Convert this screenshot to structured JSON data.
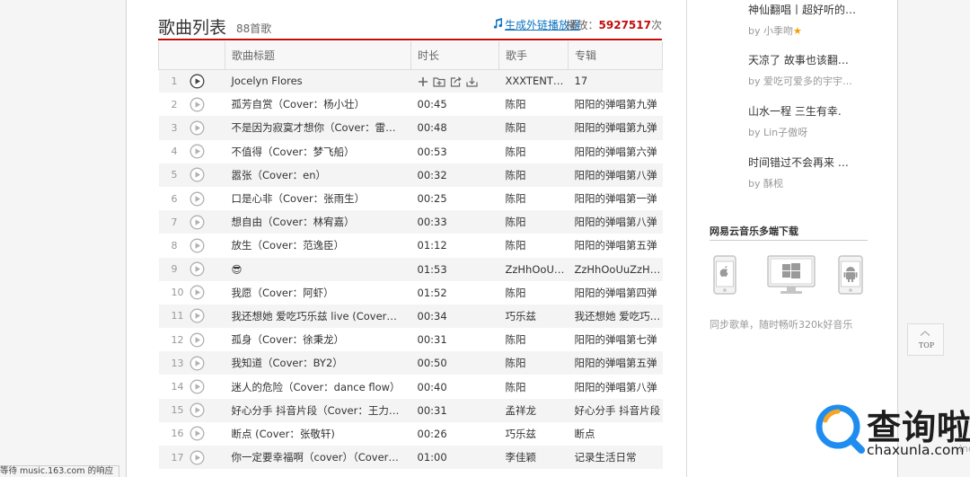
{
  "header": {
    "title": "歌曲列表",
    "count": "88首歌",
    "external_link_icon": "music-note-icon",
    "external_link": "生成外链播放器",
    "play_prefix": "播放：",
    "play_count": "5927517",
    "play_suffix": "次"
  },
  "columns": [
    "歌曲标题",
    "时长",
    "歌手",
    "专辑"
  ],
  "songs": [
    {
      "idx": "1",
      "title": "Jocelyn Flores",
      "duration": "",
      "artist": "XXXTENT…",
      "album": "17"
    },
    {
      "idx": "2",
      "title": "孤芳自赏（Cover：杨小壮）",
      "duration": "00:45",
      "artist": "陈阳",
      "album": "阳阳的弹唱第九弹"
    },
    {
      "idx": "3",
      "title": "不是因为寂寞才想你（Cover：雷…",
      "duration": "00:48",
      "artist": "陈阳",
      "album": "阳阳的弹唱第九弹"
    },
    {
      "idx": "4",
      "title": "不值得（Cover：梦飞船）",
      "duration": "00:53",
      "artist": "陈阳",
      "album": "阳阳的弹唱第六弹"
    },
    {
      "idx": "5",
      "title": "嚣张（Cover：en）",
      "duration": "00:32",
      "artist": "陈阳",
      "album": "阳阳的弹唱第八弹"
    },
    {
      "idx": "6",
      "title": "口是心非（Cover：张雨生）",
      "duration": "00:25",
      "artist": "陈阳",
      "album": "阳阳的弹唱第一弹"
    },
    {
      "idx": "7",
      "title": "想自由（Cover：林宥嘉）",
      "duration": "00:33",
      "artist": "陈阳",
      "album": "阳阳的弹唱第八弹"
    },
    {
      "idx": "8",
      "title": "放生（Cover：范逸臣）",
      "duration": "01:12",
      "artist": "陈阳",
      "album": "阳阳的弹唱第五弹"
    },
    {
      "idx": "9",
      "title": "😎",
      "duration": "01:53",
      "artist": "ZzHhOoU…",
      "album": "ZzHhOoUuZzHh…"
    },
    {
      "idx": "10",
      "title": "我愿（Cover：阿虾）",
      "duration": "01:52",
      "artist": "陈阳",
      "album": "阳阳的弹唱第四弹"
    },
    {
      "idx": "11",
      "title": "我还想她 爱吃巧乐兹 live (Cover…",
      "duration": "00:34",
      "artist": "巧乐兹",
      "album": "我还想她 爱吃巧…"
    },
    {
      "idx": "12",
      "title": "孤身（Cover：徐秉龙）",
      "duration": "00:31",
      "artist": "陈阳",
      "album": "阳阳的弹唱第七弹"
    },
    {
      "idx": "13",
      "title": "我知道（Cover：BY2）",
      "duration": "00:50",
      "artist": "陈阳",
      "album": "阳阳的弹唱第五弹"
    },
    {
      "idx": "14",
      "title": "迷人的危险（Cover：dance flow）",
      "duration": "00:40",
      "artist": "陈阳",
      "album": "阳阳的弹唱第八弹"
    },
    {
      "idx": "15",
      "title": "好心分手 抖音片段（Cover：王力…",
      "duration": "00:31",
      "artist": "孟祥龙",
      "album": "好心分手 抖音片段"
    },
    {
      "idx": "16",
      "title": "断点 (Cover：张敬轩)",
      "duration": "00:26",
      "artist": "巧乐兹",
      "album": "断点"
    },
    {
      "idx": "17",
      "title": "你一定要幸福啊（cover）（Cover…",
      "duration": "01:00",
      "artist": "李佳颖",
      "album": "记录生活日常"
    }
  ],
  "row_tools": [
    "add-icon",
    "add-to-playlist-icon",
    "share-icon",
    "download-icon"
  ],
  "sidebar": {
    "comments": [
      {
        "text": "神仙翻唱丨超好听的…",
        "by": "by 小季吻",
        "badge": "★"
      },
      {
        "text": "天凉了 故事也该翻…",
        "by": "by 爱吃可爱多的宇宇…",
        "badge": ""
      },
      {
        "text": "山水一程 三生有幸.",
        "by": "by Lin子傲呀",
        "badge": ""
      },
      {
        "text": "时间错过不会再来 …",
        "by": "by 酥枧",
        "badge": ""
      }
    ],
    "download_title": "网易云音乐多端下载",
    "download_icons": [
      "apple-icon",
      "windows-icon",
      "android-icon"
    ],
    "download_desc": "同步歌单，随时畅听320k好音乐"
  },
  "top_button": "TOP",
  "status_text": "等待 music.163.com 的响应",
  "watermark": {
    "cn": "查询啦",
    "en": "chaxunla.com",
    "edge": "inc"
  },
  "colors": {
    "accent": "#c20c0c",
    "link": "#0c73c2",
    "row_alt": "#f4f4f4",
    "badge": "#f3a000"
  }
}
